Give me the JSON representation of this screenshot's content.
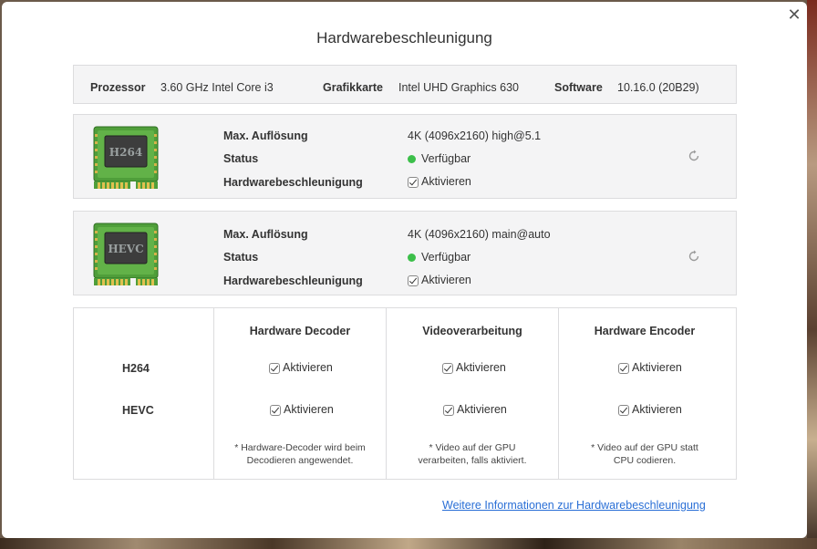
{
  "dialog": {
    "title": "Hardwarebeschleunigung",
    "close_glyph": "✕"
  },
  "system": {
    "processor_label": "Prozessor",
    "processor_value": "3.60 GHz Intel Core i3",
    "graphics_label": "Grafikkarte",
    "graphics_value": "Intel UHD Graphics 630",
    "software_label": "Software",
    "software_value": "10.16.0 (20B29)"
  },
  "codecs": [
    {
      "chip_text": "H264",
      "max_res_label": "Max. Auflösung",
      "max_res_value": "4K (4096x2160) high@5.1",
      "status_label": "Status",
      "status_value": "Verfügbar",
      "accel_label": "Hardwarebeschleunigung",
      "accel_checkbox": "Aktivieren"
    },
    {
      "chip_text": "HEVC",
      "max_res_label": "Max. Auflösung",
      "max_res_value": "4K (4096x2160) main@auto",
      "status_label": "Status",
      "status_value": "Verfügbar",
      "accel_label": "Hardwarebeschleunigung",
      "accel_checkbox": "Aktivieren"
    }
  ],
  "matrix": {
    "columns": [
      "Hardware Decoder",
      "Videoverarbeitung",
      "Hardware Encoder"
    ],
    "rows": [
      {
        "label": "H264",
        "cells": [
          "Aktivieren",
          "Aktivieren",
          "Aktivieren"
        ]
      },
      {
        "label": "HEVC",
        "cells": [
          "Aktivieren",
          "Aktivieren",
          "Aktivieren"
        ]
      }
    ],
    "notes": [
      [
        "* Hardware-Decoder wird beim",
        "Decodieren angewendet."
      ],
      [
        "* Video auf der GPU",
        "verarbeiten, falls aktiviert."
      ],
      [
        "* Video auf der GPU statt",
        "CPU codieren."
      ]
    ]
  },
  "link_text": "Weitere Informationen zur Hardwarebeschleunigung",
  "colors": {
    "accent": "#2a6fd6",
    "status_ok": "#3cbf4a",
    "panel_bg": "#f4f4f5"
  }
}
